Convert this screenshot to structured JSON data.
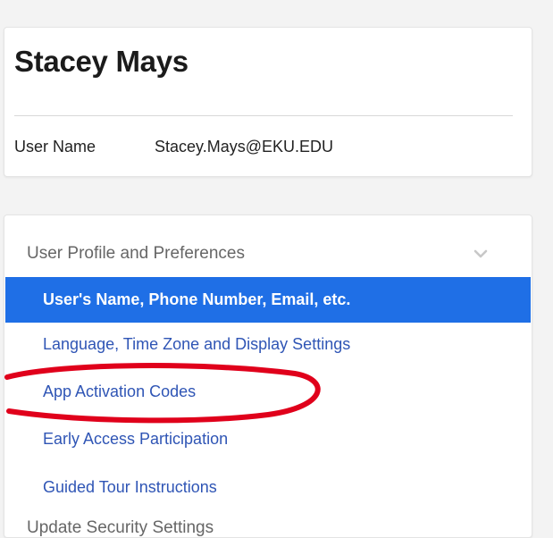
{
  "user": {
    "name": "Stacey Mays",
    "username_label": "User Name",
    "username_value": "Stacey.Mays@EKU.EDU"
  },
  "menu": {
    "section_title": "User Profile and Preferences",
    "items": [
      {
        "label": "User's Name, Phone Number, Email, etc.",
        "active": true
      },
      {
        "label": "Language, Time Zone and Display Settings",
        "active": false
      },
      {
        "label": "App Activation Codes",
        "active": false
      },
      {
        "label": "Early Access Participation",
        "active": false
      },
      {
        "label": "Guided Tour Instructions",
        "active": false
      }
    ],
    "next_section_title": "Update Security Settings"
  },
  "icons": {
    "section_toggle": "chevron-down-icon"
  },
  "colors": {
    "accent": "#1f6fe6",
    "link": "#2f55b5",
    "annotation": "#e0001b"
  }
}
